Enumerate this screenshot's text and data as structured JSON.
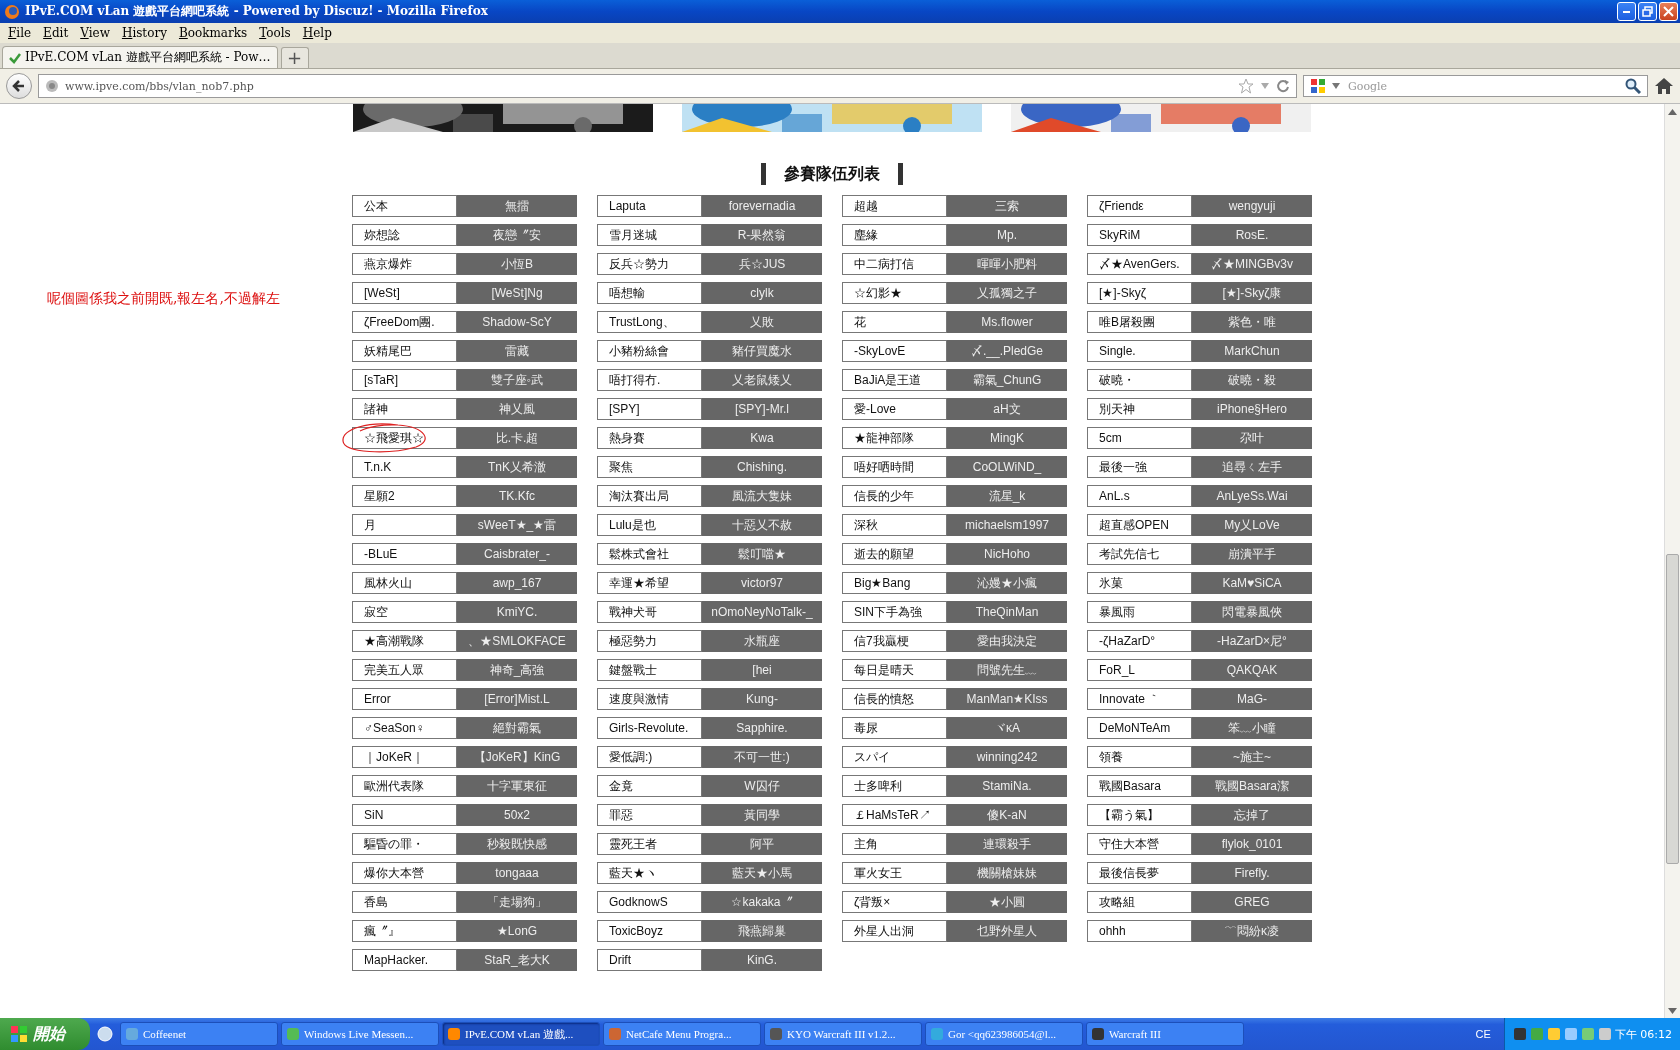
{
  "window": {
    "title": "IPvE.COM vLan 遊戲平台網吧系統 - Powered by Discuz! - Mozilla Firefox"
  },
  "menu": [
    "File",
    "Edit",
    "View",
    "History",
    "Bookmarks",
    "Tools",
    "Help"
  ],
  "tabs": [
    {
      "label": "IPvE.COM vLan 遊戲平台網吧系統 - Pow…",
      "selected": true
    }
  ],
  "new_tab": "+",
  "address_bar": {
    "value": "www.ipve.com/bbs/vlan_nob7.php"
  },
  "search": {
    "placeholder": "Google"
  },
  "note": "呢個圖係我之前開既,報左名,不過解左",
  "heading": "參賽隊伍列表",
  "team_columns": [
    [
      {
        "team": "公本",
        "member": "無擂",
        "circled": false
      },
      {
        "team": "妳想諗",
        "member": "夜戀〞安",
        "circled": false
      },
      {
        "team": "燕京爆炸",
        "member": "小恆B",
        "circled": false
      },
      {
        "team": "[WeSt]",
        "member": "[WeSt]Ng",
        "circled": false
      },
      {
        "team": "ζFreeDom團.",
        "member": "Shadow-ScY",
        "circled": false
      },
      {
        "team": "妖精尾巴",
        "member": "雷藏",
        "circled": false
      },
      {
        "team": "[sTaR]",
        "member": "雙子座◦武",
        "circled": false
      },
      {
        "team": "諸神",
        "member": "神乂風",
        "circled": false
      },
      {
        "team": "☆飛愛琪☆",
        "member": "比.卡.超",
        "circled": true
      },
      {
        "team": "T.n.K",
        "member": "TnK乂希澈",
        "circled": false
      },
      {
        "team": "星願2",
        "member": "TK.Kfc",
        "circled": false
      },
      {
        "team": "月",
        "member": "sWeeT★_★雷",
        "circled": false
      },
      {
        "team": "-BLuE",
        "member": "Caisbrater_-",
        "circled": false
      },
      {
        "team": "風林火山",
        "member": "awp_167",
        "circled": false
      },
      {
        "team": "寂空",
        "member": "KmiYC.",
        "circled": false
      },
      {
        "team": "★高潮戰隊",
        "member": "、★SMLOKFACE",
        "circled": false
      },
      {
        "team": "完美五人眾",
        "member": "神奇_高強",
        "circled": false
      },
      {
        "team": "Error",
        "member": "[Error]Mist.L",
        "circled": false
      },
      {
        "team": "♂SeaSon♀",
        "member": "絕對霸氣",
        "circled": false
      },
      {
        "team": "｜JoKeR｜",
        "member": "【JoKeR】KinG",
        "circled": false
      },
      {
        "team": "歐洲代表隊",
        "member": "十字軍東征",
        "circled": false
      },
      {
        "team": "SiN",
        "member": "50x2",
        "circled": false
      },
      {
        "team": "驅昏の罪・",
        "member": "秒殺既快感",
        "circled": false
      },
      {
        "team": "爆你大本營",
        "member": "tongaaa",
        "circled": false
      },
      {
        "team": "香島",
        "member": "「走場狗」",
        "circled": false
      },
      {
        "team": "瘋〞』",
        "member": "★LonG",
        "circled": false
      },
      {
        "team": "MapHacker.",
        "member": "StaR_老大K",
        "circled": false
      }
    ],
    [
      {
        "team": "Laputa",
        "member": "forevernadia",
        "circled": false
      },
      {
        "team": "雪月迷城",
        "member": "R-果然翁",
        "circled": false
      },
      {
        "team": "反兵☆勢力",
        "member": "兵☆JUS",
        "circled": false
      },
      {
        "team": "唔想輸",
        "member": "clylk",
        "circled": false
      },
      {
        "team": "TrustLong、",
        "member": "乂敗",
        "circled": false
      },
      {
        "team": "小豬粉絲會",
        "member": "豬仔買魔水",
        "circled": false
      },
      {
        "team": "唔打得冇.",
        "member": "乂老鼠矮乂",
        "circled": false
      },
      {
        "team": "[SPY]",
        "member": "[SPY]-Mr.l",
        "circled": false
      },
      {
        "team": "熱身賽",
        "member": "Kwa",
        "circled": false
      },
      {
        "team": "聚焦",
        "member": "Chishing.",
        "circled": false
      },
      {
        "team": "淘汰賽出局",
        "member": "風流大隻妹",
        "circled": false
      },
      {
        "team": "Lulu是也",
        "member": "十惡乂不赦",
        "circled": false
      },
      {
        "team": "鬆株式會社",
        "member": "鬆叮噹★",
        "circled": false
      },
      {
        "team": "幸運★希望",
        "member": "victor97",
        "circled": false
      },
      {
        "team": "戰神犬哥",
        "member": "nOmoNeyNoTalk-_",
        "circled": false
      },
      {
        "team": "極惡勢力",
        "member": "水瓶座",
        "circled": false
      },
      {
        "team": "鍵盤戰士",
        "member": "[hei",
        "circled": false
      },
      {
        "team": "速度與激情",
        "member": "Kung-",
        "circled": false
      },
      {
        "team": "Girls-Revolute.",
        "member": "Sapphire.",
        "circled": false
      },
      {
        "team": "愛低調:)",
        "member": "不可一世:)",
        "circled": false
      },
      {
        "team": "金竟",
        "member": "W囚仔",
        "circled": false
      },
      {
        "team": "罪惡",
        "member": "黃同學",
        "circled": false
      },
      {
        "team": "靈死王者",
        "member": "阿平",
        "circled": false
      },
      {
        "team": "藍天★ヽ",
        "member": "藍天★小馬",
        "circled": false
      },
      {
        "team": "GodknowS",
        "member": "☆kakaka〞",
        "circled": false
      },
      {
        "team": "ToxicBoyz",
        "member": "飛燕歸巢",
        "circled": false
      },
      {
        "team": "Drift",
        "member": "KinG.",
        "circled": false
      }
    ],
    [
      {
        "team": "超越",
        "member": "三索",
        "circled": false
      },
      {
        "team": "塵緣",
        "member": "Mp.",
        "circled": false
      },
      {
        "team": "中二病打信",
        "member": "暉暉小肥料",
        "circled": false
      },
      {
        "team": "☆幻影★",
        "member": "乂孤獨之子",
        "circled": false
      },
      {
        "team": "花",
        "member": "Ms.flower",
        "circled": false
      },
      {
        "team": "-SkyLovE",
        "member": "〆.__.PledGe",
        "circled": false
      },
      {
        "team": "BaJiA是王道",
        "member": "霸氣_ChunG",
        "circled": false
      },
      {
        "team": "愛-Love",
        "member": "aH文",
        "circled": false
      },
      {
        "team": "★龍神部隊",
        "member": "MingK",
        "circled": false
      },
      {
        "team": "唔好哂時間",
        "member": "CoOLWiND_",
        "circled": false
      },
      {
        "team": "信長的少年",
        "member": "流星_k",
        "circled": false
      },
      {
        "team": "深秋",
        "member": "michaelsm1997",
        "circled": false
      },
      {
        "team": "逝去的願望",
        "member": "NicHoho",
        "circled": false
      },
      {
        "team": "Big★Bang",
        "member": "沁嫚★小瘋",
        "circled": false
      },
      {
        "team": "SIN下手為強",
        "member": "TheQinMan",
        "circled": false
      },
      {
        "team": "信7我贏梗",
        "member": "愛由我決定",
        "circled": false
      },
      {
        "team": "每日是晴天",
        "member": "問號先生﹏",
        "circled": false
      },
      {
        "team": "信長的憤怒",
        "member": "ManMan★KIss",
        "circled": false
      },
      {
        "team": "毒尿",
        "member": "ヾκA",
        "circled": false
      },
      {
        "team": "スパイ",
        "member": "winning242",
        "circled": false
      },
      {
        "team": "士多啤利",
        "member": "StamiNa.",
        "circled": false
      },
      {
        "team": "￡HaMsTeR↗",
        "member": "傻K-aN",
        "circled": false
      },
      {
        "team": "主角",
        "member": "連環殺手",
        "circled": false
      },
      {
        "team": "軍火女王",
        "member": "機關槍妹妹",
        "circled": false
      },
      {
        "team": "ζ背叛×",
        "member": "★小圓",
        "circled": false
      },
      {
        "team": "外星人出洞",
        "member": "乜野外星人",
        "circled": false
      }
    ],
    [
      {
        "team": "ζFriendε",
        "member": "wengyuji",
        "circled": false
      },
      {
        "team": "SkyRiM",
        "member": "RosE.",
        "circled": false
      },
      {
        "team": "〆★AvenGers.",
        "member": "〆★MINGBv3v",
        "circled": false
      },
      {
        "team": "[★]-Skyζ",
        "member": "[★]-Skyζ康",
        "circled": false
      },
      {
        "team": "唯B屠殺團",
        "member": "紫色・唯",
        "circled": false
      },
      {
        "team": "Single.",
        "member": "MarkChun",
        "circled": false
      },
      {
        "team": "破曉・",
        "member": "破曉・殺",
        "circled": false
      },
      {
        "team": "別天神",
        "member": "iPhone§Hero",
        "circled": false
      },
      {
        "team": "5cm",
        "member": "尕叶",
        "circled": false
      },
      {
        "team": "最後一強",
        "member": "追尋ㄑ左手",
        "circled": false
      },
      {
        "team": "AnL.s",
        "member": "AnLyeSs.Wai",
        "circled": false
      },
      {
        "team": "超直感OPEN",
        "member": "My乂LoVe",
        "circled": false
      },
      {
        "team": "考試先信七",
        "member": "崩潰平手",
        "circled": false
      },
      {
        "team": "氷菓",
        "member": "KaM♥SiCA",
        "circled": false
      },
      {
        "team": "暴風雨",
        "member": "閃電暴風俠",
        "circled": false
      },
      {
        "team": "-ζHaZarD°",
        "member": "-HaZarD×尼°",
        "circled": false
      },
      {
        "team": "FoR_L",
        "member": "QAKQAK",
        "circled": false
      },
      {
        "team": "Innovate ｀",
        "member": "MaG-",
        "circled": false
      },
      {
        "team": "DeMoNTeAm",
        "member": "笨﹏小瞳",
        "circled": false
      },
      {
        "team": "領養",
        "member": "~施主~",
        "circled": false
      },
      {
        "team": "戰國Basara",
        "member": "戰國Basara潔",
        "circled": false
      },
      {
        "team": "【霸う氣】",
        "member": "忘掉了",
        "circled": false
      },
      {
        "team": "守住大本營",
        "member": "flylok_0101",
        "circled": false
      },
      {
        "team": "最後信長夢",
        "member": "Firefly.",
        "circled": false
      },
      {
        "team": "攻略組",
        "member": "GREG",
        "circled": false
      },
      {
        "team": "ohhh",
        "member": "﹋悶紛κ凌",
        "circled": false
      }
    ]
  ],
  "taskbar": {
    "start": "開始",
    "items": [
      {
        "label": "Coffeenet",
        "selected": false
      },
      {
        "label": "Windows Live Messen...",
        "selected": false
      },
      {
        "label": "IPvE.COM vLan 遊戲...",
        "selected": true
      },
      {
        "label": "NetCafe Menu Progra...",
        "selected": false
      },
      {
        "label": "KYO Warcraft III v1.2...",
        "selected": false
      },
      {
        "label": "Gor <qq623986054@l...",
        "selected": false
      },
      {
        "label": "Warcraft III",
        "selected": false
      }
    ],
    "language": "CE",
    "clock": "下午 06:12"
  }
}
